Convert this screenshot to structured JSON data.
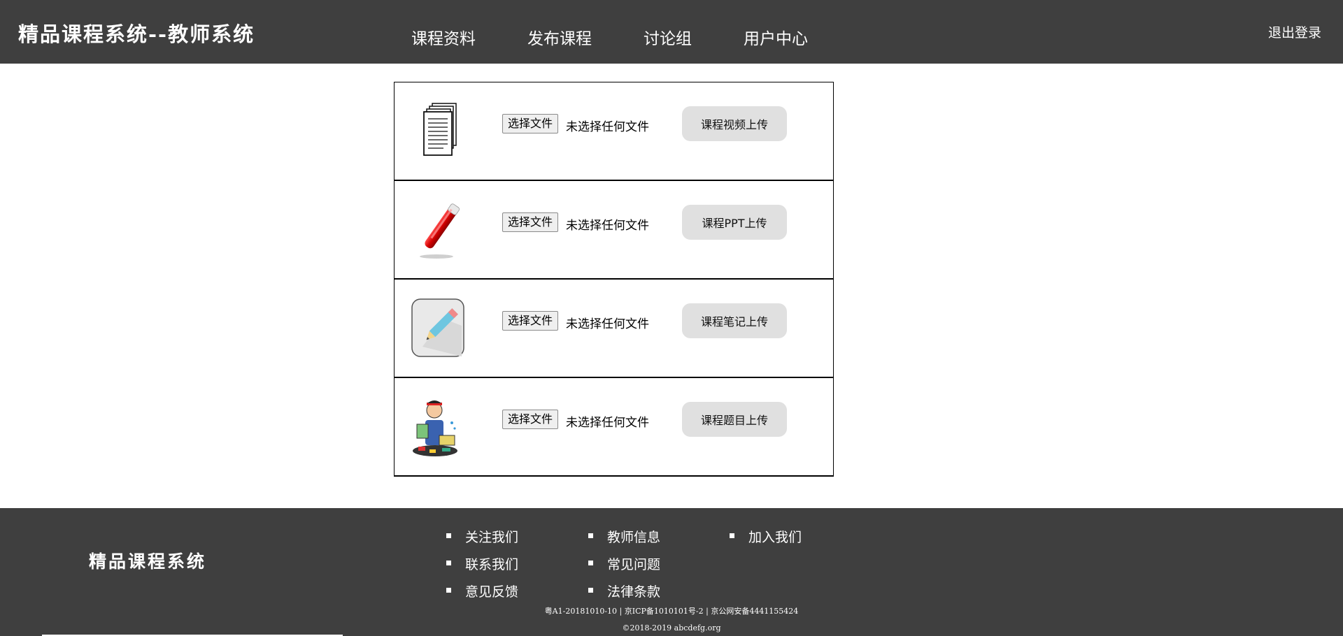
{
  "header": {
    "brand": "精品课程系统--教师系统",
    "nav": [
      "课程资料",
      "发布课程",
      "讨论组",
      "用户中心"
    ],
    "logout": "退出登录"
  },
  "upload_rows": [
    {
      "icon": "documents-icon",
      "choose_label": "选择文件",
      "file_status": "未选择任何文件",
      "upload_label": "课程视频上传"
    },
    {
      "icon": "red-pen-icon",
      "choose_label": "选择文件",
      "file_status": "未选择任何文件",
      "upload_label": "课程PPT上传"
    },
    {
      "icon": "notepad-pencil-icon",
      "choose_label": "选择文件",
      "file_status": "未选择任何文件",
      "upload_label": "课程笔记上传"
    },
    {
      "icon": "stressed-student-icon",
      "choose_label": "选择文件",
      "file_status": "未选择任何文件",
      "upload_label": "课程题目上传"
    }
  ],
  "footer": {
    "brand": "精品课程系统",
    "links": [
      [
        "关注我们",
        "联系我们",
        "意见反馈"
      ],
      [
        "教师信息",
        "常见问题",
        "法律条款"
      ],
      [
        "加入我们"
      ]
    ],
    "legal": "粤A1-20181010-10 | 京ICP备1010101号-2 | 京公网安备4441155424",
    "copyright": "©2018-2019 abcdefg.org"
  }
}
